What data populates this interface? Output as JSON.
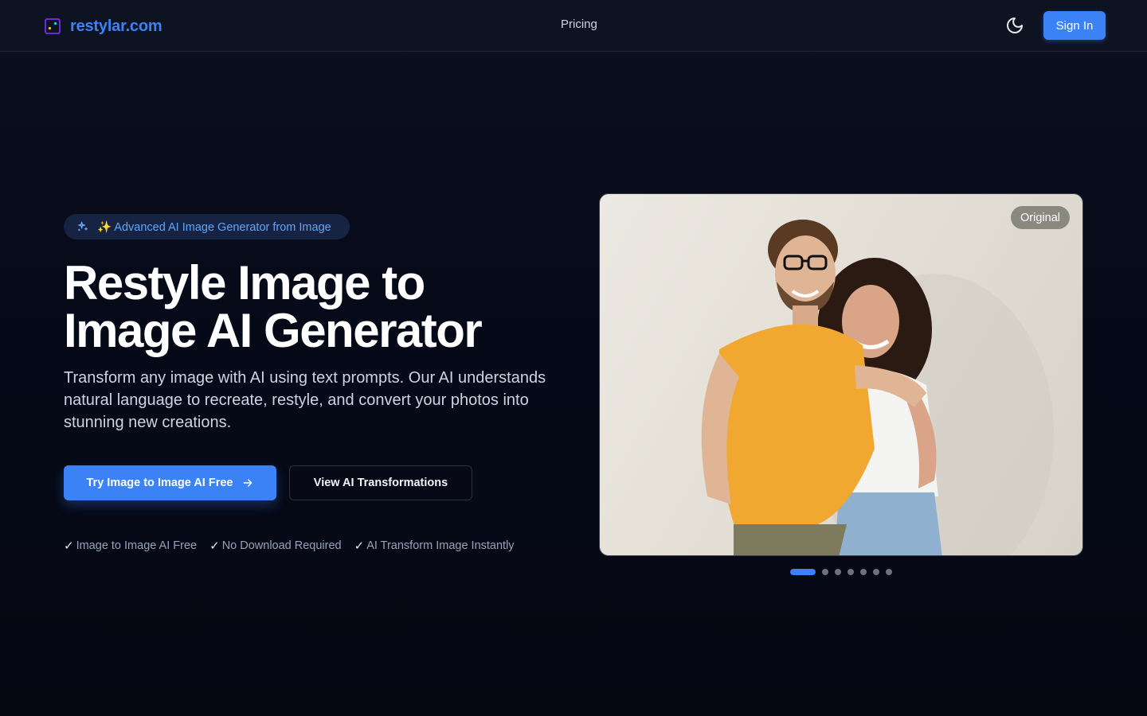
{
  "header": {
    "logo_text": "restylar.com",
    "nav_pricing": "Pricing",
    "sign_in": "Sign In"
  },
  "hero": {
    "badge": "✨ Advanced AI Image Generator from Image",
    "headline": "Restyle Image to Image AI Generator",
    "subtext": "Transform any image with AI using text prompts. Our AI understands natural language to recreate, restyle, and convert your photos into stunning new creations.",
    "primary_button": "Try Image to Image AI Free",
    "secondary_button": "View AI Transformations",
    "features": [
      "Image to Image AI Free",
      "No Download Required",
      "AI Transform Image Instantly"
    ]
  },
  "carousel": {
    "tag": "Original",
    "slide_count": 7,
    "active_index": 0
  },
  "colors": {
    "accent": "#3b82f6",
    "background": "#070b1a"
  },
  "icons": {
    "logo": "sparkle-square-icon",
    "theme": "moon-icon",
    "badge": "sparkles-icon",
    "button": "arrow-right-icon",
    "feature": "check-icon"
  }
}
